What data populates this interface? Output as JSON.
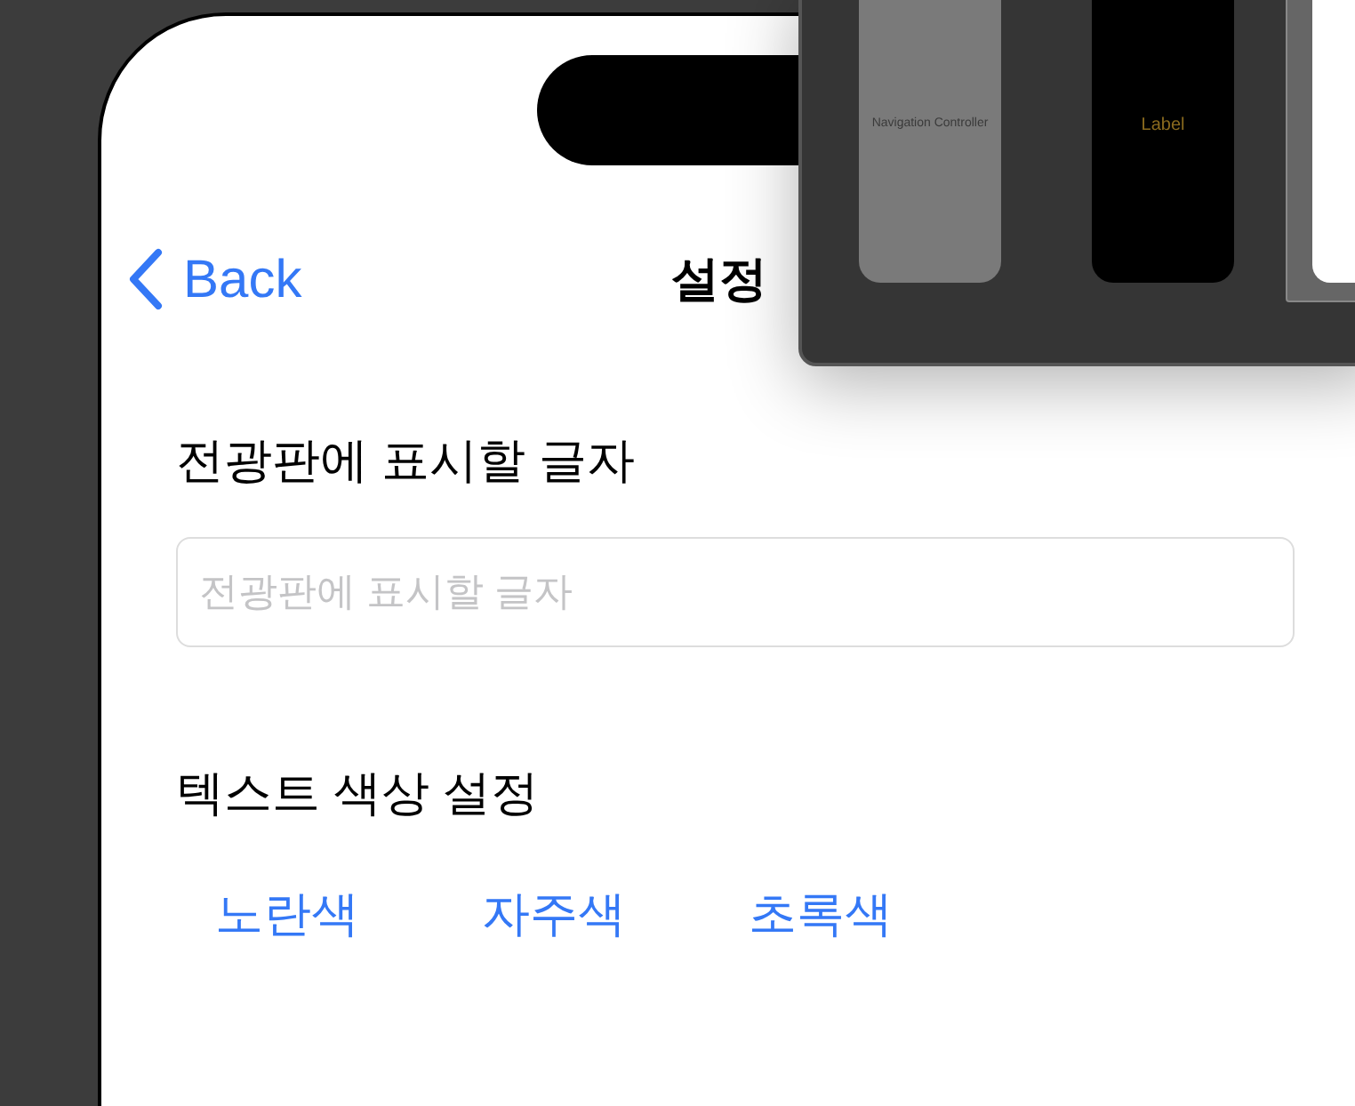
{
  "nav": {
    "back": "Back",
    "title": "설정"
  },
  "text_section": {
    "label": "전광판에 표시할 글자",
    "field": {
      "placeholder": "전광판에 표시할 글자"
    }
  },
  "color_section": {
    "label": "텍스트 색상 설정",
    "buttons": [
      "노란색",
      "자주색",
      "초록색"
    ]
  },
  "storyboard_overview": {
    "scenes": [
      {
        "kind": "navigation",
        "label": "Navigation Controller"
      },
      {
        "kind": "label",
        "label": "Label"
      },
      {
        "kind": "settings"
      }
    ]
  }
}
